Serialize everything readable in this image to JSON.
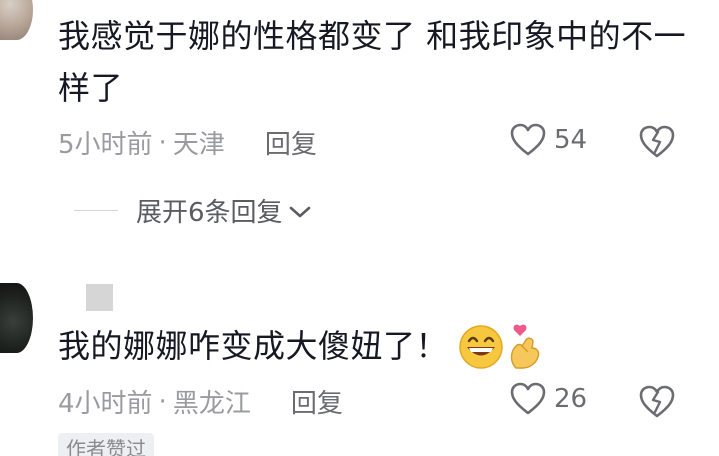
{
  "comments": [
    {
      "text": "我感觉于娜的性格都变了 和我印象中的不一样了",
      "time": "5小时前",
      "separator": "·",
      "location": "天津",
      "reply_label": "回复",
      "like_count": "54",
      "expand_replies_label": "展开6条回复"
    },
    {
      "text": "我的娜娜咋变成大傻妞了！",
      "emojis": [
        "grinning-face",
        "finger-heart"
      ],
      "time": "4小时前",
      "separator": "·",
      "location": "黑龙江",
      "reply_label": "回复",
      "like_count": "26",
      "author_badge": "作者赞过"
    }
  ],
  "colors": {
    "text_primary": "#161823",
    "text_secondary": "#9a9ba0",
    "icon_gray": "#6b6c72"
  }
}
